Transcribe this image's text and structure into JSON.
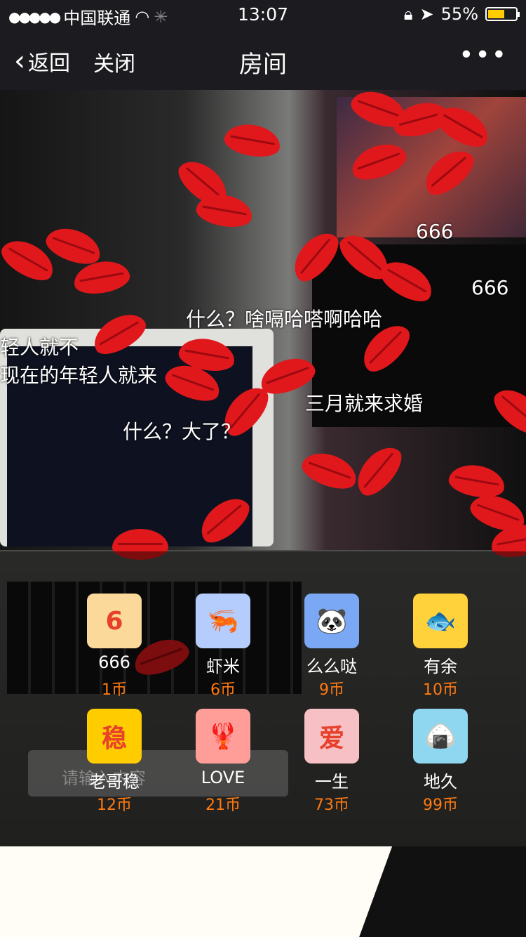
{
  "status_bar": {
    "signal": "●●●●●",
    "carrier": "中国联通",
    "time": "13:07",
    "battery": "55%",
    "battery_level": 0.55,
    "battery_color": "#ffcc00"
  },
  "nav": {
    "back": "返回",
    "close": "关闭",
    "title": "房间",
    "more": "•••"
  },
  "danmaku": [
    "666",
    "666",
    "什么？啥嗝哈嗒啊哈哈",
    "轻人就不",
    "现在的年轻人就来",
    "三月就来求婚",
    "什么？大了？"
  ],
  "input": {
    "placeholder": "请输入内容"
  },
  "gifts": [
    {
      "name": "666",
      "price": "1币",
      "icon": "666-icon",
      "color": "#fbd99a",
      "glyph": "6"
    },
    {
      "name": "虾米",
      "price": "6币",
      "icon": "shrimp-icon",
      "color": "#b5cdfc",
      "glyph": "🦐"
    },
    {
      "name": "么么哒",
      "price": "9币",
      "icon": "panda-icon",
      "color": "#7aa8f5",
      "glyph": "🐼"
    },
    {
      "name": "有余",
      "price": "10币",
      "icon": "fish-icon",
      "color": "#ffd23c",
      "glyph": "🐟"
    },
    {
      "name": "老哥稳",
      "price": "12币",
      "icon": "wen-icon",
      "color": "#ffcc00",
      "glyph": "稳"
    },
    {
      "name": "LOVE",
      "price": "21币",
      "icon": "lobster-icon",
      "color": "#ff9e98",
      "glyph": "🦞"
    },
    {
      "name": "一生",
      "price": "73币",
      "icon": "can-icon",
      "color": "#f7c0c4",
      "glyph": "爱"
    },
    {
      "name": "地久",
      "price": "99币",
      "icon": "onigiri-icon",
      "color": "#8fd6f0",
      "glyph": "🍙"
    }
  ],
  "colors": {
    "price": "#ff7a10",
    "lips": "#e0181c"
  }
}
